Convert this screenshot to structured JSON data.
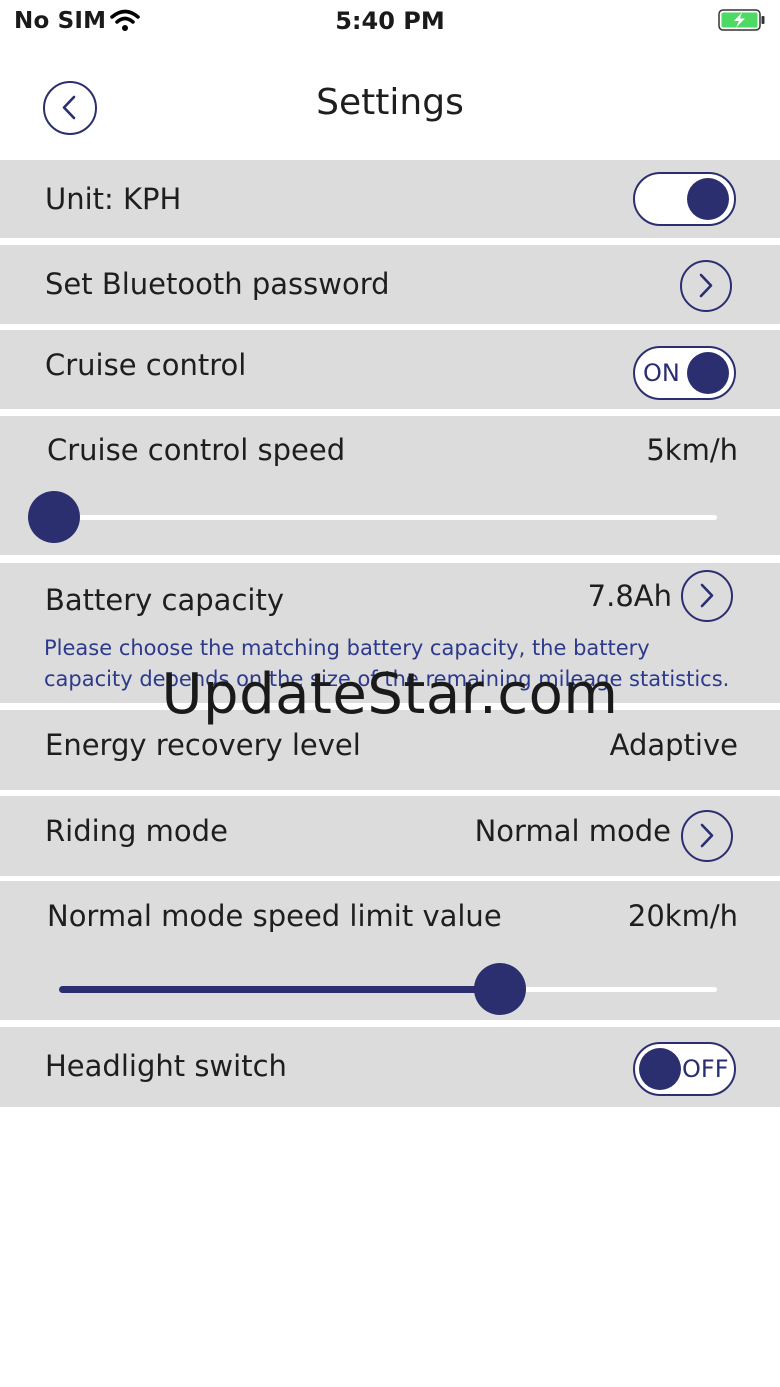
{
  "status_bar": {
    "carrier": "No SIM",
    "time": "5:40 PM",
    "wifi_icon": "wifi-icon",
    "battery_icon": "battery-charging-icon"
  },
  "nav": {
    "title": "Settings",
    "back_icon": "chevron-left-icon"
  },
  "settings": {
    "unit": {
      "label": "Unit:  KPH",
      "toggle_on": true
    },
    "bluetooth_password": {
      "label": "Set Bluetooth password"
    },
    "cruise_control": {
      "label": "Cruise control",
      "toggle_text": "ON",
      "toggle_on": true
    },
    "cruise_speed": {
      "label": "Cruise control speed",
      "value": "5km/h",
      "slider_fraction": 0.0
    },
    "battery_capacity": {
      "label": "Battery capacity",
      "value": "7.8Ah",
      "note": "Please choose the matching battery capacity, the battery capacity depends on the size of the remaining mileage statistics."
    },
    "energy_recovery": {
      "label": "Energy recovery level",
      "value": "Adaptive"
    },
    "riding_mode": {
      "label": "Riding mode",
      "value": "Normal mode"
    },
    "speed_limit": {
      "label": "Normal mode speed limit value",
      "value": "20km/h",
      "slider_fraction": 0.67
    },
    "headlight": {
      "label": "Headlight switch",
      "toggle_text": "OFF",
      "toggle_on": false
    }
  },
  "watermark": "UpdateStar.com",
  "colors": {
    "accent": "#2b2e6f",
    "row_bg": "#dcdcdc",
    "note": "#2d3a8c",
    "battery": "#4cd964"
  }
}
